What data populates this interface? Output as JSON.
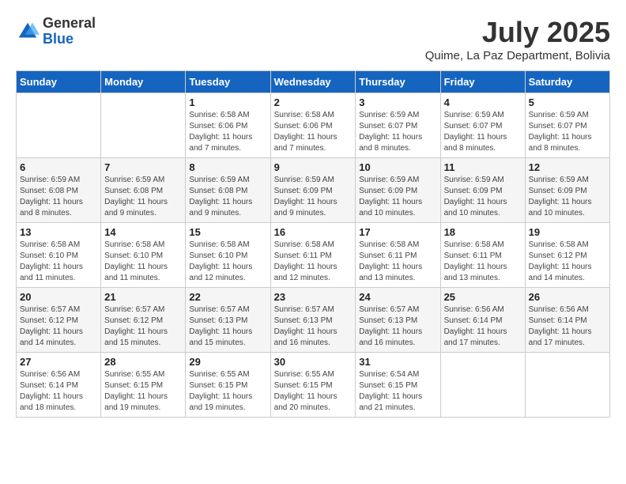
{
  "logo": {
    "general": "General",
    "blue": "Blue"
  },
  "title": "July 2025",
  "subtitle": "Quime, La Paz Department, Bolivia",
  "days_of_week": [
    "Sunday",
    "Monday",
    "Tuesday",
    "Wednesday",
    "Thursday",
    "Friday",
    "Saturday"
  ],
  "weeks": [
    [
      {
        "day": "",
        "info": ""
      },
      {
        "day": "",
        "info": ""
      },
      {
        "day": "1",
        "info": "Sunrise: 6:58 AM\nSunset: 6:06 PM\nDaylight: 11 hours and 7 minutes."
      },
      {
        "day": "2",
        "info": "Sunrise: 6:58 AM\nSunset: 6:06 PM\nDaylight: 11 hours and 7 minutes."
      },
      {
        "day": "3",
        "info": "Sunrise: 6:59 AM\nSunset: 6:07 PM\nDaylight: 11 hours and 8 minutes."
      },
      {
        "day": "4",
        "info": "Sunrise: 6:59 AM\nSunset: 6:07 PM\nDaylight: 11 hours and 8 minutes."
      },
      {
        "day": "5",
        "info": "Sunrise: 6:59 AM\nSunset: 6:07 PM\nDaylight: 11 hours and 8 minutes."
      }
    ],
    [
      {
        "day": "6",
        "info": "Sunrise: 6:59 AM\nSunset: 6:08 PM\nDaylight: 11 hours and 8 minutes."
      },
      {
        "day": "7",
        "info": "Sunrise: 6:59 AM\nSunset: 6:08 PM\nDaylight: 11 hours and 9 minutes."
      },
      {
        "day": "8",
        "info": "Sunrise: 6:59 AM\nSunset: 6:08 PM\nDaylight: 11 hours and 9 minutes."
      },
      {
        "day": "9",
        "info": "Sunrise: 6:59 AM\nSunset: 6:09 PM\nDaylight: 11 hours and 9 minutes."
      },
      {
        "day": "10",
        "info": "Sunrise: 6:59 AM\nSunset: 6:09 PM\nDaylight: 11 hours and 10 minutes."
      },
      {
        "day": "11",
        "info": "Sunrise: 6:59 AM\nSunset: 6:09 PM\nDaylight: 11 hours and 10 minutes."
      },
      {
        "day": "12",
        "info": "Sunrise: 6:59 AM\nSunset: 6:09 PM\nDaylight: 11 hours and 10 minutes."
      }
    ],
    [
      {
        "day": "13",
        "info": "Sunrise: 6:58 AM\nSunset: 6:10 PM\nDaylight: 11 hours and 11 minutes."
      },
      {
        "day": "14",
        "info": "Sunrise: 6:58 AM\nSunset: 6:10 PM\nDaylight: 11 hours and 11 minutes."
      },
      {
        "day": "15",
        "info": "Sunrise: 6:58 AM\nSunset: 6:10 PM\nDaylight: 11 hours and 12 minutes."
      },
      {
        "day": "16",
        "info": "Sunrise: 6:58 AM\nSunset: 6:11 PM\nDaylight: 11 hours and 12 minutes."
      },
      {
        "day": "17",
        "info": "Sunrise: 6:58 AM\nSunset: 6:11 PM\nDaylight: 11 hours and 13 minutes."
      },
      {
        "day": "18",
        "info": "Sunrise: 6:58 AM\nSunset: 6:11 PM\nDaylight: 11 hours and 13 minutes."
      },
      {
        "day": "19",
        "info": "Sunrise: 6:58 AM\nSunset: 6:12 PM\nDaylight: 11 hours and 14 minutes."
      }
    ],
    [
      {
        "day": "20",
        "info": "Sunrise: 6:57 AM\nSunset: 6:12 PM\nDaylight: 11 hours and 14 minutes."
      },
      {
        "day": "21",
        "info": "Sunrise: 6:57 AM\nSunset: 6:12 PM\nDaylight: 11 hours and 15 minutes."
      },
      {
        "day": "22",
        "info": "Sunrise: 6:57 AM\nSunset: 6:13 PM\nDaylight: 11 hours and 15 minutes."
      },
      {
        "day": "23",
        "info": "Sunrise: 6:57 AM\nSunset: 6:13 PM\nDaylight: 11 hours and 16 minutes."
      },
      {
        "day": "24",
        "info": "Sunrise: 6:57 AM\nSunset: 6:13 PM\nDaylight: 11 hours and 16 minutes."
      },
      {
        "day": "25",
        "info": "Sunrise: 6:56 AM\nSunset: 6:14 PM\nDaylight: 11 hours and 17 minutes."
      },
      {
        "day": "26",
        "info": "Sunrise: 6:56 AM\nSunset: 6:14 PM\nDaylight: 11 hours and 17 minutes."
      }
    ],
    [
      {
        "day": "27",
        "info": "Sunrise: 6:56 AM\nSunset: 6:14 PM\nDaylight: 11 hours and 18 minutes."
      },
      {
        "day": "28",
        "info": "Sunrise: 6:55 AM\nSunset: 6:15 PM\nDaylight: 11 hours and 19 minutes."
      },
      {
        "day": "29",
        "info": "Sunrise: 6:55 AM\nSunset: 6:15 PM\nDaylight: 11 hours and 19 minutes."
      },
      {
        "day": "30",
        "info": "Sunrise: 6:55 AM\nSunset: 6:15 PM\nDaylight: 11 hours and 20 minutes."
      },
      {
        "day": "31",
        "info": "Sunrise: 6:54 AM\nSunset: 6:15 PM\nDaylight: 11 hours and 21 minutes."
      },
      {
        "day": "",
        "info": ""
      },
      {
        "day": "",
        "info": ""
      }
    ]
  ]
}
